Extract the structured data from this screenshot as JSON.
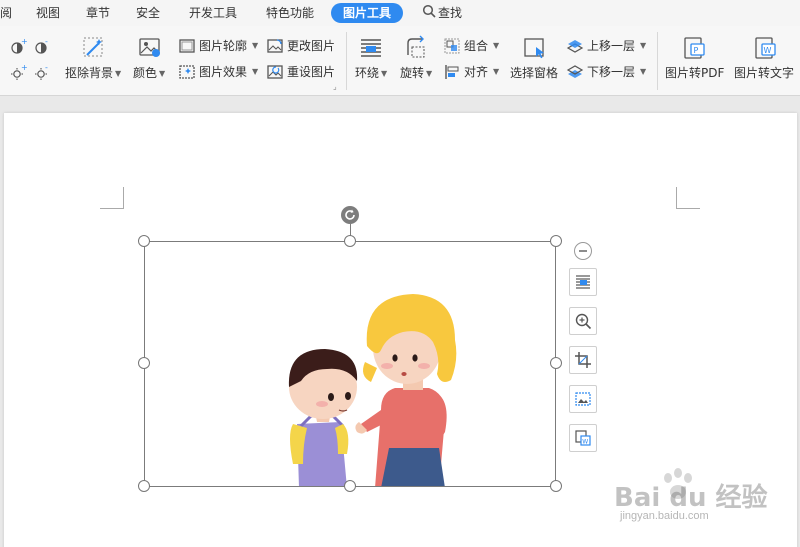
{
  "menu": {
    "tabs": [
      {
        "label": "阅",
        "active": false
      },
      {
        "label": "视图",
        "active": false
      },
      {
        "label": "章节",
        "active": false
      },
      {
        "label": "安全",
        "active": false
      },
      {
        "label": "开发工具",
        "active": false
      },
      {
        "label": "特色功能",
        "active": false
      },
      {
        "label": "图片工具",
        "active": true
      },
      {
        "label": "查找",
        "active": false
      }
    ]
  },
  "ribbon": {
    "remove_bg": "抠除背景",
    "color": "颜色",
    "outline": "图片轮廓",
    "effects": "图片效果",
    "change_pic": "更改图片",
    "reset_pic": "重设图片",
    "wrap": "环绕",
    "rotate": "旋转",
    "group": "组合",
    "align": "对齐",
    "selection_pane": "选择窗格",
    "bring_forward": "上移一层",
    "send_backward": "下移一层",
    "to_pdf": "图片转PDF",
    "to_text": "图片转文字"
  },
  "watermark": {
    "brand": "Bai du 经验",
    "url": "jingyan.baidu.com"
  },
  "colors": {
    "accent": "#2f8af0",
    "ribbon_bg": "#f7f7f7",
    "doc_bg": "#e9e9e9"
  }
}
